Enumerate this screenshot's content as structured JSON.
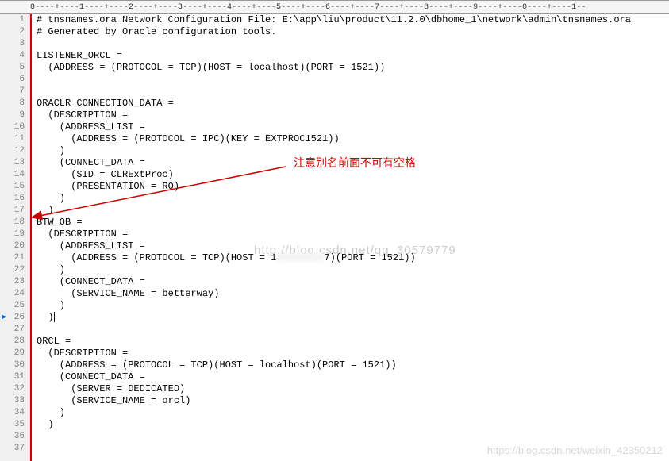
{
  "ruler_text": "0----+----1----+----2----+----3----+----4----+----5----+----6----+----7----+----8----+----9----+----0----+----1--",
  "annotation_text": "注意别名前面不可有空格",
  "watermark1": "http://blog.csdn.net/qq_30579779",
  "watermark2": "https://blog.csdn.net/weixin_42350212",
  "lines": [
    "# tnsnames.ora Network Configuration File: E:\\app\\liu\\product\\11.2.0\\dbhome_1\\network\\admin\\tnsnames.ora",
    "# Generated by Oracle configuration tools.",
    "",
    "LISTENER_ORCL =",
    "  (ADDRESS = (PROTOCOL = TCP)(HOST = localhost)(PORT = 1521))",
    "",
    "",
    "ORACLR_CONNECTION_DATA =",
    "  (DESCRIPTION =",
    "    (ADDRESS_LIST =",
    "      (ADDRESS = (PROTOCOL = IPC)(KEY = EXTPROC1521))",
    "    )",
    "    (CONNECT_DATA =",
    "      (SID = CLRExtProc)",
    "      (PRESENTATION = RO)",
    "    )",
    "  )",
    "BTW_OB =",
    "  (DESCRIPTION =",
    "    (ADDRESS_LIST =",
    "      (ADDRESS = (PROTOCOL = TCP)(HOST = 1          7)(PORT = 1521))",
    "    )",
    "    (CONNECT_DATA =",
    "      (SERVICE_NAME = betterway)",
    "    )",
    "  )",
    "",
    "ORCL =",
    "  (DESCRIPTION =",
    "    (ADDRESS = (PROTOCOL = TCP)(HOST = localhost)(PORT = 1521))",
    "    (CONNECT_DATA =",
    "      (SERVER = DEDICATED)",
    "      (SERVICE_NAME = orcl)",
    "    )",
    "  )",
    "",
    ""
  ],
  "line_numbers": [
    "1",
    "2",
    "3",
    "4",
    "5",
    "6",
    "7",
    "8",
    "9",
    "10",
    "11",
    "12",
    "13",
    "14",
    "15",
    "16",
    "17",
    "18",
    "19",
    "20",
    "21",
    "22",
    "23",
    "24",
    "25",
    "26",
    "27",
    "28",
    "29",
    "30",
    "31",
    "32",
    "33",
    "34",
    "35",
    "36",
    "37"
  ]
}
